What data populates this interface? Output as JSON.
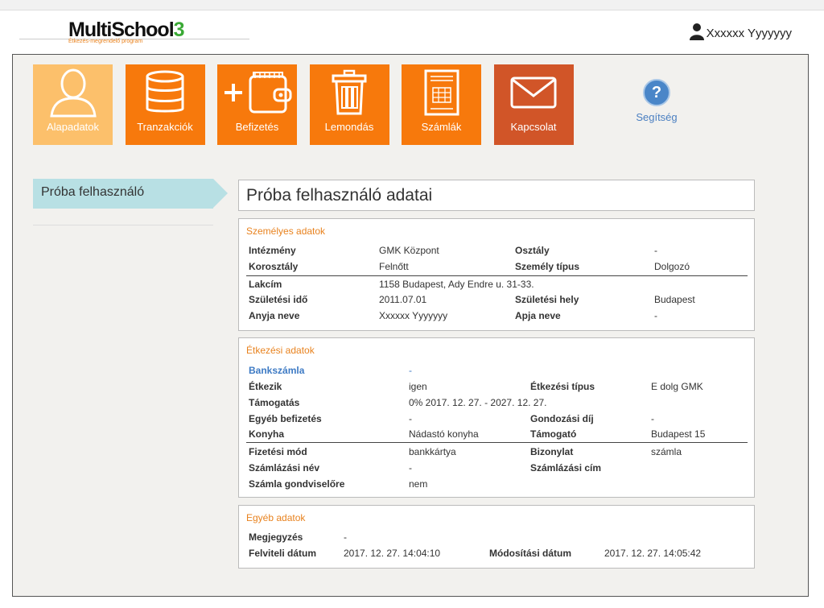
{
  "header": {
    "logo_main": "MultiSchool",
    "logo_num": "3",
    "logo_sub": "Étkezés-megrendelő program",
    "user_name": "Xxxxxx Yyyyyyy"
  },
  "tiles": [
    {
      "label": "Alapadatok",
      "icon": "user-icon"
    },
    {
      "label": "Tranzakciók",
      "icon": "database-icon"
    },
    {
      "label": "Befizetés",
      "icon": "wallet-plus-icon"
    },
    {
      "label": "Lemondás",
      "icon": "trash-icon"
    },
    {
      "label": "Számlák",
      "icon": "invoice-icon"
    },
    {
      "label": "Kapcsolat",
      "icon": "envelope-icon"
    }
  ],
  "help": {
    "label": "Segítség",
    "symbol": "?"
  },
  "sidebar": {
    "active_user": "Próba felhasználó"
  },
  "page_title": "Próba felhasználó adatai",
  "personal": {
    "title": "Személyes adatok",
    "rows": [
      [
        "Intézmény",
        "GMK Központ",
        "Osztály",
        "-"
      ],
      [
        "Korosztály",
        "Felnőtt",
        "Személy típus",
        "Dolgozó"
      ],
      [
        "Lakcím",
        "1158 Budapest, Ady Endre u. 31-33.",
        "",
        ""
      ],
      [
        "Születési idő",
        "2011.07.01",
        "Születési hely",
        "Budapest"
      ],
      [
        "Anyja neve",
        "Xxxxxx Yyyyyyy",
        "Apja neve",
        "-"
      ]
    ]
  },
  "meal": {
    "title": "Étkezési adatok",
    "rows": [
      [
        "Bankszámla",
        "-",
        "",
        ""
      ],
      [
        "Étkezik",
        "igen",
        "Étkezési típus",
        "E dolg GMK"
      ],
      [
        "Támogatás",
        "0% 2017. 12. 27. - 2027. 12. 27.",
        "",
        ""
      ],
      [
        "Egyéb befizetés",
        "-",
        "Gondozási díj",
        "-"
      ],
      [
        "Konyha",
        "Nádastó konyha",
        "Támogató",
        "Budapest 15"
      ],
      [
        "Fizetési mód",
        "bankkártya",
        "Bizonylat",
        "számla"
      ],
      [
        "Számlázási név",
        "-",
        "Számlázási cím",
        ""
      ],
      [
        "Számla gondviselőre",
        "nem",
        "",
        ""
      ]
    ]
  },
  "other": {
    "title": "Egyéb adatok",
    "rows": [
      [
        "Megjegyzés",
        "-",
        "",
        ""
      ],
      [
        "Felviteli dátum",
        "2017. 12. 27. 14:04:10",
        "Módosítási dátum",
        "2017. 12. 27. 14:05:42"
      ]
    ]
  },
  "colors": {
    "orange": "#f7790c",
    "orange_light": "#fcc06b",
    "orange_dark": "#d15528",
    "section_title": "#e8821e",
    "link_blue": "#3d7ac4",
    "tab_bg": "#b8e0e4"
  }
}
